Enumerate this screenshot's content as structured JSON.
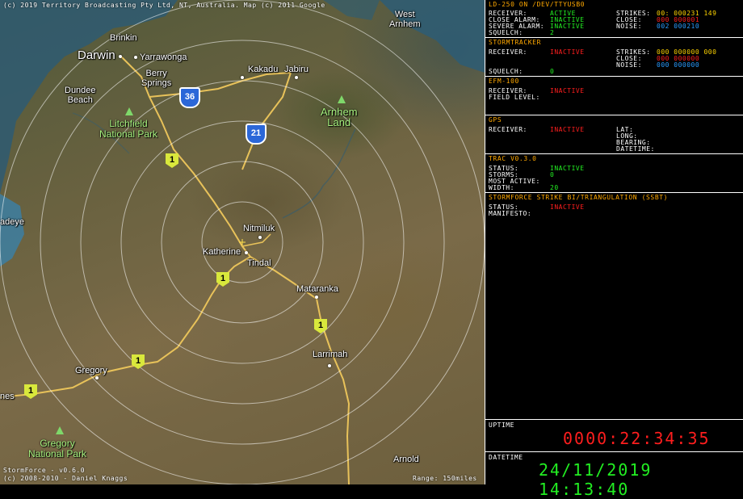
{
  "map": {
    "copyright": "(c) 2019 Territory Broadcasting Pty Ltd, NT, Australia. Map (c) 2011 Google",
    "places": {
      "west_arnhem": "West\nArnhem",
      "brinkin": "Brinkin",
      "darwin": "Darwin",
      "yarrawonga": "Yarrawonga",
      "berry_springs": "Berry\nSprings",
      "dundee_beach": "Dundee\nBeach",
      "kakadu": "Kakadu",
      "jabiru": "Jabiru",
      "litchfield": "Litchfield\nNational Park",
      "arnhem_land": "Arnhem\nLand",
      "nitmiluk": "Nitmiluk",
      "katherine": "Katherine",
      "tindal": "Tindal",
      "mataranka": "Mataranka",
      "larrimah": "Larrimah",
      "gregory": "Gregory",
      "gregory_np": "Gregory\nNational Park",
      "adeye": "adeye",
      "nes": "nes",
      "arnold": "Arnold"
    },
    "shields": {
      "hwy36": "36",
      "hwy21": "21",
      "route1": "1"
    },
    "version": "StormForce - v0.6.0",
    "author": "(c) 2008-2010 - Daniel Knaggs",
    "range": "Range: 150miles"
  },
  "panel": {
    "ld250": {
      "title": "LD-250 on /dev/ttyUSB0",
      "receiver_label": "Receiver:",
      "receiver_value": "Active",
      "close_alarm_label": "Close Alarm:",
      "close_alarm_value": "Inactive",
      "severe_alarm_label": "Severe Alarm:",
      "severe_alarm_value": "Inactive",
      "squelch_label": "Squelch:",
      "squelch_value": "2",
      "strikes_label": "Strikes:",
      "strikes_value": "00: 000231 149",
      "close_label": "Close:",
      "close_value": "000 000001",
      "noise_label": "Noise:",
      "noise_value": "002 000210"
    },
    "stormtracker": {
      "title": "StormTracker",
      "receiver_label": "Receiver:",
      "receiver_value": "Inactive",
      "squelch_label": "Squelch:",
      "squelch_value": "0",
      "strikes_label": "Strikes:",
      "strikes_value": "000 000000 000",
      "close_label": "Close:",
      "close_value": "000 000000",
      "noise_label": "Noise:",
      "noise_value": "000 000000"
    },
    "efm100": {
      "title": "EFM-100",
      "receiver_label": "Receiver:",
      "receiver_value": "Inactive",
      "field_label": "Field Level:"
    },
    "gps": {
      "title": "GPS",
      "receiver_label": "Receiver:",
      "receiver_value": "Inactive",
      "lat_label": "Lat:",
      "long_label": "Long:",
      "bearing_label": "Bearing:",
      "datetime_label": "DateTime:"
    },
    "trac": {
      "title": "TRAC v0.3.0",
      "status_label": "Status:",
      "status_value": "Inactive",
      "storms_label": "Storms:",
      "storms_value": "0",
      "most_active_label": "Most Active:",
      "width_label": "Width:",
      "width_value": "20"
    },
    "sst": {
      "title": "StormForce Strike Bi/Triangulation (SSBT)",
      "status_label": "Status:",
      "status_value": "Inactive",
      "manifesto_label": "Manifesto:"
    },
    "uptime": {
      "title": "Uptime",
      "value": "0000:22:34:35"
    },
    "datetime": {
      "title": "DateTime",
      "value": "24/11/2019 14:13:40"
    }
  },
  "colors": {
    "active": "#22ee22",
    "inactive": "#ff1e1e",
    "section_title": "#ffa800",
    "strikes": "#ffd400",
    "close": "#ff1e1e",
    "noise": "#2a9cff"
  }
}
